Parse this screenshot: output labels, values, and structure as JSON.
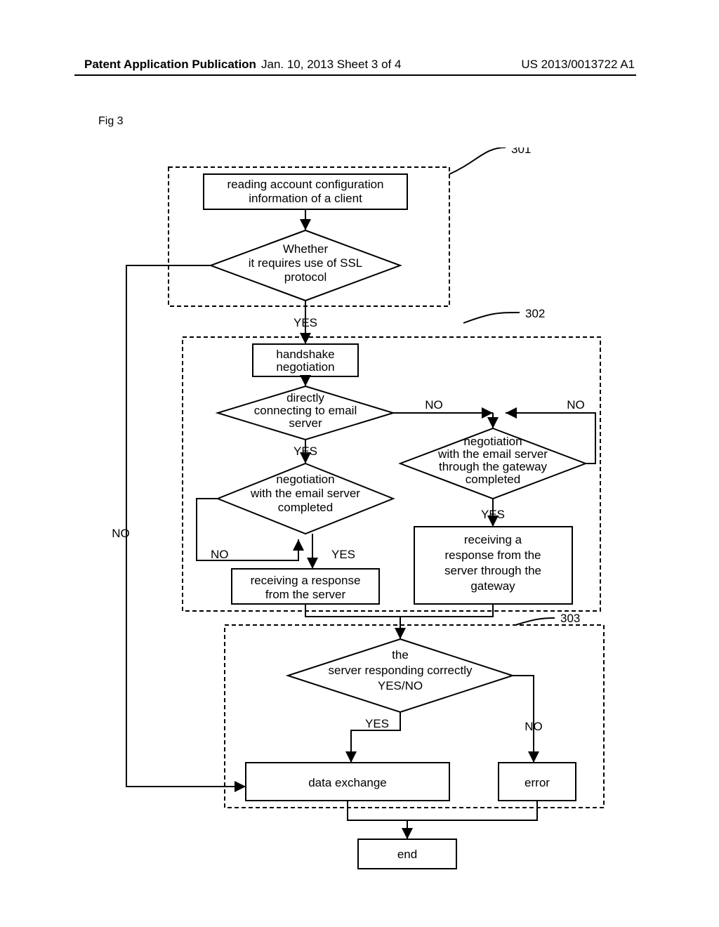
{
  "header": {
    "left": "Patent Application Publication",
    "middle": "Jan. 10, 2013  Sheet 3 of 4",
    "right": "US 2013/0013722 A1"
  },
  "figure_label": "Fig 3",
  "callouts": {
    "c1": "301",
    "c2": "302",
    "c3": "303"
  },
  "nodes": {
    "read_config": [
      "reading account configuration",
      "information of a client"
    ],
    "ssl_decision": [
      "Whether",
      "it requires use of SSL",
      "protocol"
    ],
    "handshake": [
      "handshake",
      "negotiation"
    ],
    "direct_decision": [
      "directly",
      "connecting to email",
      "server"
    ],
    "neg_direct": [
      "negotiation",
      "with the email server",
      "completed"
    ],
    "neg_gateway": [
      "negotiation",
      "with the email server",
      "through the gateway",
      "completed"
    ],
    "resp_direct": [
      "receiving a response",
      "from the server"
    ],
    "resp_gateway": [
      "receiving a",
      "response from the",
      "server through the",
      "gateway"
    ],
    "resp_correct": [
      "the",
      "server responding correctly",
      "YES/NO"
    ],
    "data_exchange": "data exchange",
    "error": "error",
    "end": "end"
  },
  "labels": {
    "yes": "YES",
    "no": "NO"
  }
}
